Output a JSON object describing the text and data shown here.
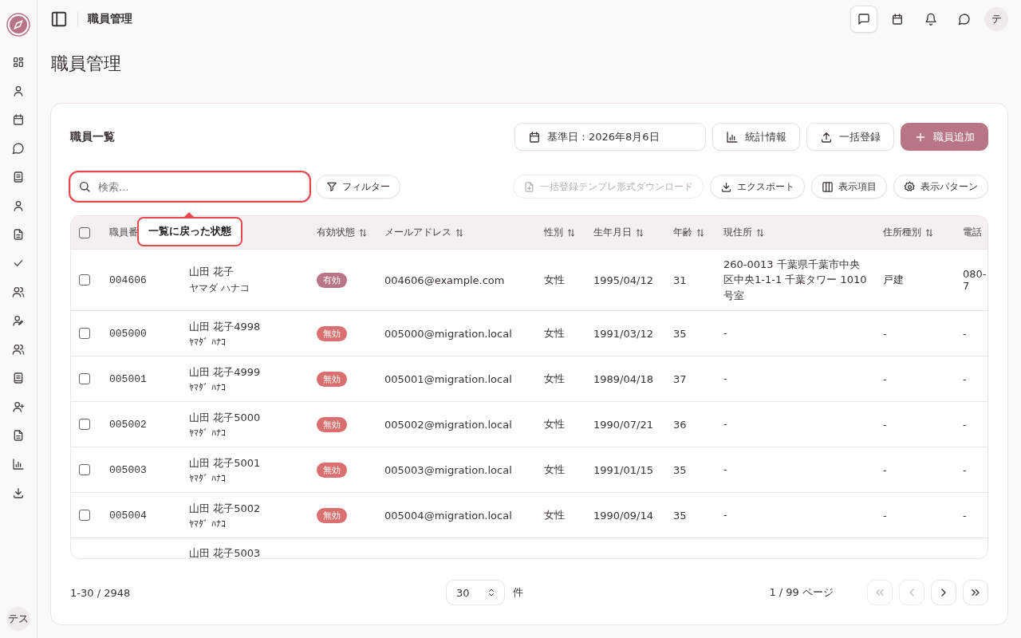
{
  "sidebar": {
    "avatar": "テス"
  },
  "topbar": {
    "title": "職員管理",
    "actions": [
      {
        "selected": true
      },
      {
        "selected": false
      },
      {
        "selected": false
      },
      {
        "selected": false
      }
    ],
    "avatar": "テ"
  },
  "page_title": "職員管理",
  "card": {
    "title": "職員一覧",
    "header_buttons": [
      {
        "kind": "date",
        "label": "基準日：2026年8月6日"
      },
      {
        "kind": "stats",
        "label": "統計情報"
      },
      {
        "kind": "import",
        "label": "一括登録"
      },
      {
        "kind": "add",
        "label": "職員追加"
      }
    ],
    "search": {
      "placeholder": "検索...",
      "highlighted": true
    },
    "filter_button": "フィルター",
    "tool_buttons": [
      {
        "kind": "template",
        "label": "一括登録テンプレ形式ダウンロード",
        "disabled": true
      },
      {
        "kind": "export",
        "label": "エクスポート",
        "disabled": false
      },
      {
        "kind": "columns",
        "label": "表示項目",
        "disabled": false
      },
      {
        "kind": "pattern",
        "label": "表示パターン",
        "disabled": false
      }
    ],
    "tooltip": "一覧に戻った状態",
    "table": {
      "select_all_checked": false,
      "columns": [
        {
          "label": "職員番"
        },
        {},
        {
          "label": "有効状態",
          "sortable": true
        },
        {
          "label": "メールアドレス",
          "sortable": true
        },
        {
          "label": "性別",
          "sortable": true
        },
        {
          "label": "生年月日",
          "sortable": true
        },
        {
          "label": "年齢",
          "sortable": true
        },
        {
          "label": "現住所",
          "sortable": true
        },
        {
          "label": "住所種別",
          "sortable": true
        },
        {
          "label": "電話"
        }
      ],
      "rows": [
        {
          "kind": "full",
          "checked": false,
          "id": "004606",
          "name": "山田 花子",
          "kana": "ヤマダ ハナコ",
          "status": {
            "label": "有効",
            "active": true
          },
          "email": "004606@example.com",
          "gender": "女性",
          "birth": "1995/04/12",
          "age": "31",
          "address": "260-0013 千葉県千葉市中央区中央1-1-1 千葉タワー 1010号室",
          "address_type": "戸建",
          "phone": "080-7"
        },
        {
          "kind": "full",
          "checked": false,
          "id": "005000",
          "name": "山田 花子4998",
          "kana": "ﾔﾏﾀﾞ ﾊﾅｺ",
          "status": {
            "label": "無効",
            "active": false
          },
          "email": "005000@migration.local",
          "gender": "女性",
          "birth": "1991/03/12",
          "age": "35",
          "address": "-",
          "address_type": "-",
          "phone": "-"
        },
        {
          "kind": "full",
          "checked": false,
          "id": "005001",
          "name": "山田 花子4999",
          "kana": "ﾔﾏﾀﾞ ﾊﾅｺ",
          "status": {
            "label": "無効",
            "active": false
          },
          "email": "005001@migration.local",
          "gender": "女性",
          "birth": "1989/04/18",
          "age": "37",
          "address": "-",
          "address_type": "-",
          "phone": "-"
        },
        {
          "kind": "full",
          "checked": false,
          "id": "005002",
          "name": "山田 花子5000",
          "kana": "ﾔﾏﾀﾞ ﾊﾅｺ",
          "status": {
            "label": "無効",
            "active": false
          },
          "email": "005002@migration.local",
          "gender": "女性",
          "birth": "1990/07/21",
          "age": "36",
          "address": "-",
          "address_type": "-",
          "phone": "-"
        },
        {
          "kind": "full",
          "checked": false,
          "id": "005003",
          "name": "山田 花子5001",
          "kana": "ﾔﾏﾀﾞ ﾊﾅｺ",
          "status": {
            "label": "無効",
            "active": false
          },
          "email": "005003@migration.local",
          "gender": "女性",
          "birth": "1991/01/15",
          "age": "35",
          "address": "-",
          "address_type": "-",
          "phone": "-"
        },
        {
          "kind": "full",
          "checked": false,
          "id": "005004",
          "name": "山田 花子5002",
          "kana": "ﾔﾏﾀﾞ ﾊﾅｺ",
          "status": {
            "label": "無効",
            "active": false
          },
          "email": "005004@migration.local",
          "gender": "女性",
          "birth": "1990/09/14",
          "age": "35",
          "address": "-",
          "address_type": "-",
          "phone": "-"
        },
        {
          "kind": "cut",
          "name": "山田 花子5003"
        }
      ]
    },
    "footer": {
      "range": "1-30 / 2948",
      "page_size": "30",
      "unit": "件",
      "page": "1 / 99 ページ",
      "nav": [
        {
          "kind": "first",
          "disabled": true
        },
        {
          "kind": "prev",
          "disabled": true
        },
        {
          "kind": "next",
          "disabled": false
        },
        {
          "kind": "last",
          "disabled": false
        }
      ]
    }
  }
}
